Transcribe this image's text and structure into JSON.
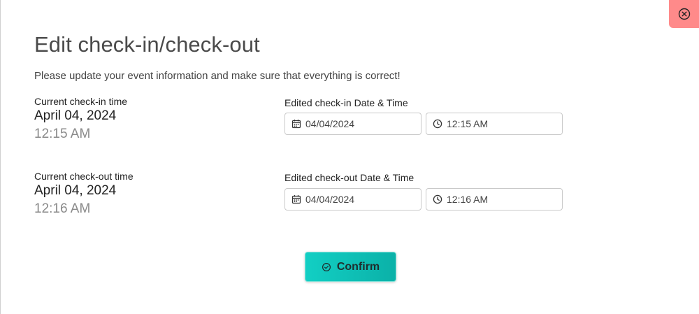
{
  "modal": {
    "title": "Edit check-in/check-out",
    "subtitle": "Please update your event information and make sure that everything is correct!"
  },
  "check_in": {
    "current_label": "Current check-in time",
    "current_date": "April 04, 2024",
    "current_time": "12:15 AM",
    "edited_label": "Edited check-in Date & Time",
    "date_value": "04/04/2024",
    "time_value": "12:15 AM"
  },
  "check_out": {
    "current_label": "Current check-out time",
    "current_date": "April 04, 2024",
    "current_time": "12:16 AM",
    "edited_label": "Edited check-out Date & Time",
    "date_value": "04/04/2024",
    "time_value": "12:16 AM"
  },
  "actions": {
    "confirm_label": "Confirm"
  },
  "icons": {
    "close": "close-circle-icon",
    "date": "calendar-icon",
    "time": "clock-icon",
    "confirm": "check-circle-icon"
  },
  "colors": {
    "close_bg": "#ff8a8a",
    "confirm_gradient_start": "#12cfc4",
    "confirm_gradient_end": "#0bb1a8"
  }
}
